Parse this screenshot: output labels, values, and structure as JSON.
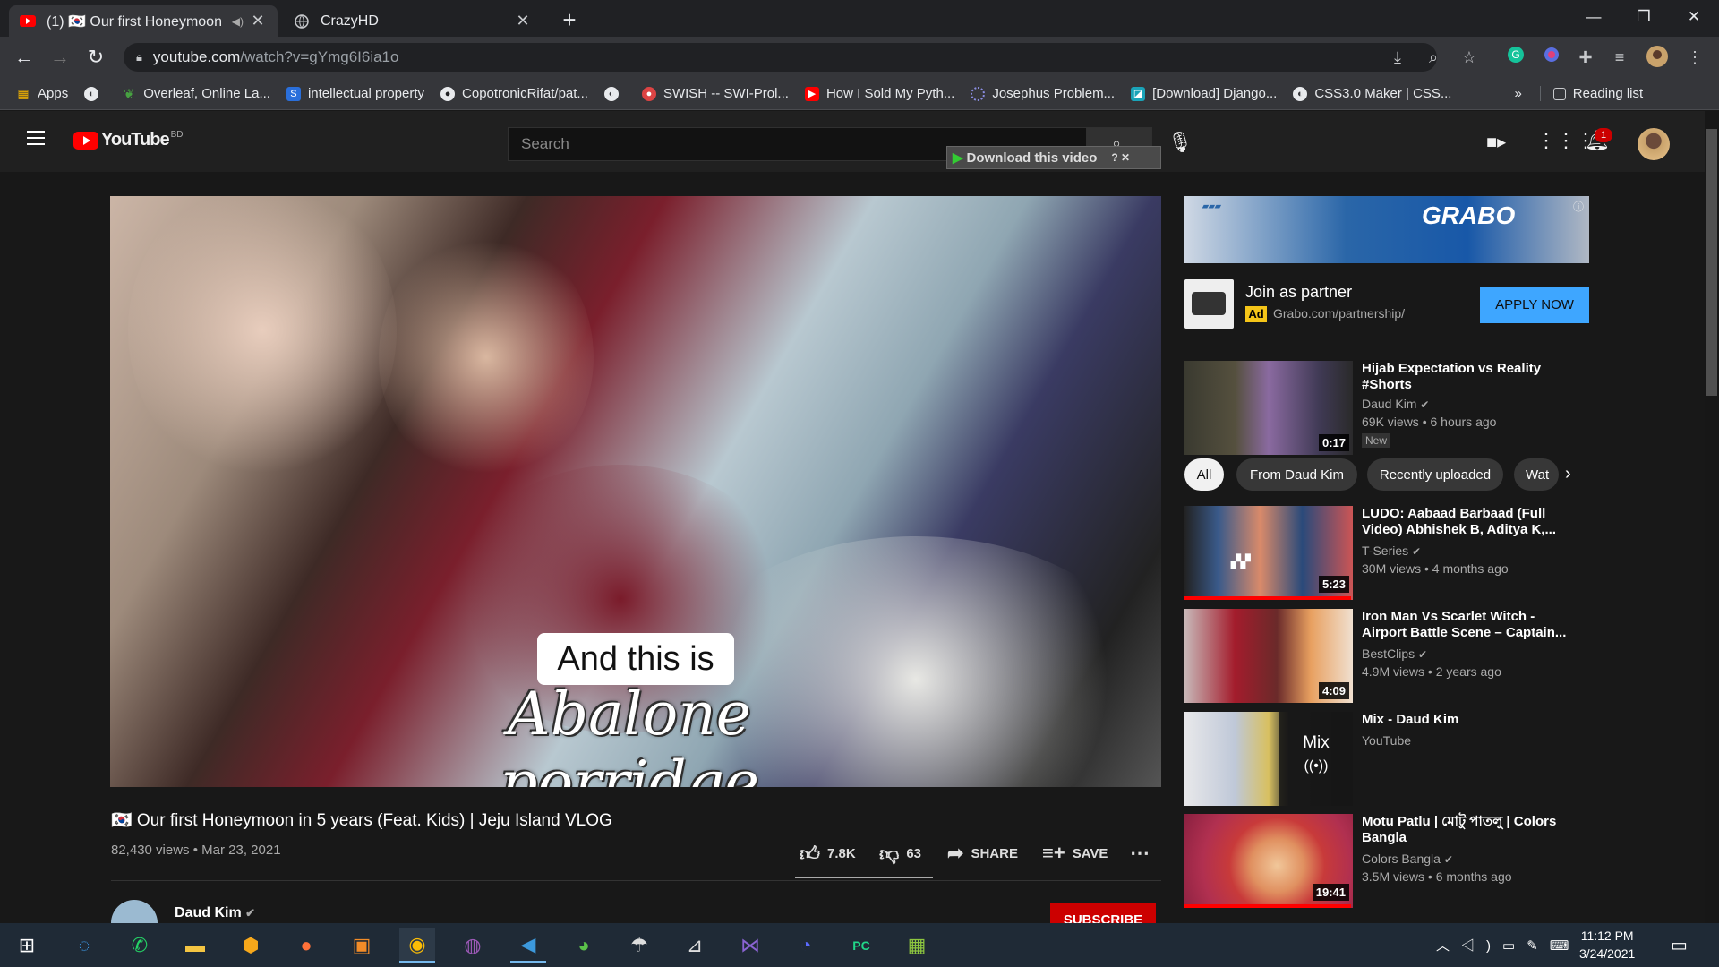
{
  "tabs": [
    {
      "title": "(1) 🇰🇷 Our first Honeymoon i",
      "active": true
    },
    {
      "title": "CrazyHD",
      "active": false
    }
  ],
  "window": {
    "minimize": "—",
    "restore": "❐",
    "close": "✕"
  },
  "address": {
    "host": "youtube.com",
    "path": "/watch?v=gYmg6I6ia1o"
  },
  "bookmarks": {
    "apps": "Apps",
    "items": [
      "Overleaf, Online La...",
      "intellectual property",
      "CopotronicRifat/pat...",
      "SWISH -- SWI-Prol...",
      "How I Sold My Pyth...",
      "Josephus Problem...",
      "[Download] Django...",
      "CSS3.0 Maker | CSS..."
    ],
    "more": "»",
    "reading_list": "Reading list"
  },
  "youtube": {
    "logo": "YouTube",
    "region": "BD",
    "search_placeholder": "Search",
    "download_button": "Download this video",
    "notification_count": "1"
  },
  "video": {
    "caption_top": "And this is",
    "caption_bottom": "Abalone porridge",
    "title": "🇰🇷 Our first Honeymoon in 5 years (Feat. Kids) | Jeju Island VLOG",
    "views": "82,430 views",
    "date": "Mar 23, 2021",
    "likes": "7.8K",
    "dislikes": "63",
    "share": "SHARE",
    "save": "SAVE",
    "channel": "Daud Kim",
    "subscribe": "SUBSCRIBE"
  },
  "ad": {
    "banner_brand": "GRABO",
    "title": "Join as partner",
    "badge": "Ad",
    "url": "Grabo.com/partnership/",
    "cta": "APPLY NOW"
  },
  "chips": [
    "All",
    "From Daud Kim",
    "Recently uploaded",
    "Wat"
  ],
  "recommendations": [
    {
      "title": "Hijab Expectation vs Reality #Shorts",
      "channel": "Daud Kim",
      "meta": "69K views • 6 hours ago",
      "duration": "0:17",
      "badge": "New"
    },
    {
      "title": "LUDO: Aabaad Barbaad (Full Video) Abhishek B, Aditya K,...",
      "channel": "T-Series",
      "meta": "30M views • 4 months ago",
      "duration": "5:23"
    },
    {
      "title": "Iron Man Vs Scarlet Witch - Airport Battle Scene – Captain...",
      "channel": "BestClips",
      "meta": "4.9M views • 2 years ago",
      "duration": "4:09"
    },
    {
      "title": "Mix - Daud Kim",
      "channel": "YouTube",
      "meta": "",
      "duration": "Mix"
    },
    {
      "title": "Motu Patlu | মোটু পাতলু | Colors Bangla",
      "channel": "Colors Bangla",
      "meta": "3.5M views • 6 months ago",
      "duration": "19:41"
    }
  ],
  "progress": {
    "rec1": 0.99,
    "rec4": 0.99
  },
  "clock": {
    "time": "11:12 PM",
    "date": "3/24/2021"
  },
  "colors": {
    "youtube_red": "#ff0000",
    "accent_blue": "#3ea6ff",
    "subscribe_red": "#cc0000"
  }
}
